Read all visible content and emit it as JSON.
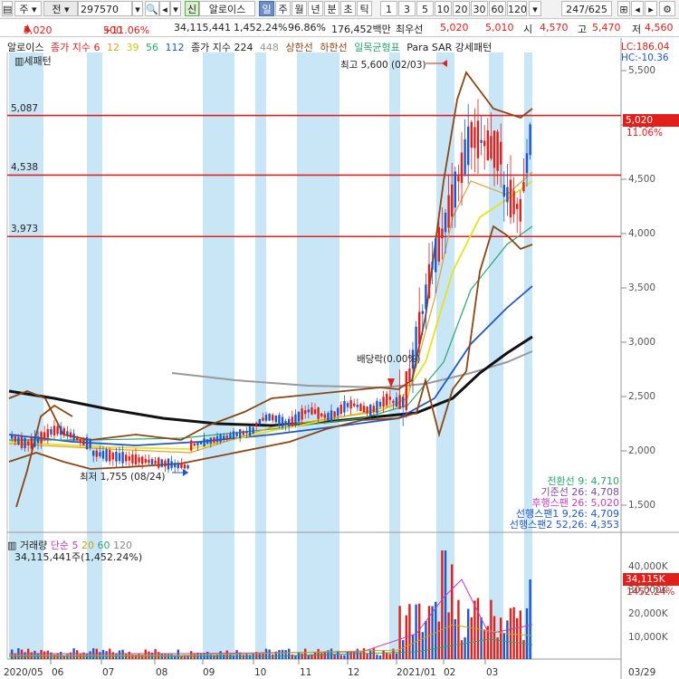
{
  "toolbar": {
    "market": "주",
    "code_label": "전",
    "code": "297570",
    "stock_name": "알로이스",
    "new_badge": "신",
    "period_items": [
      "일",
      "주",
      "월",
      "년",
      "분",
      "초",
      "틱"
    ],
    "selected_period": "일",
    "interval_items": [
      "1",
      "3",
      "5",
      "10",
      "20",
      "30",
      "60",
      "120"
    ],
    "page_counter": "247/625"
  },
  "quote": {
    "price": "5,020",
    "change": "500",
    "change_pct": "+11.06%",
    "volume": "34,115,441",
    "volume_pct": "1,452.24%",
    "volume_pct2": "96.86%",
    "trade_value": "176,452백만",
    "best_label": "최우선",
    "best_price": "5,020",
    "best_price2": "5,010",
    "open_label": "시",
    "open": "4,570",
    "high_label": "고",
    "high": "5,470",
    "low_label": "저",
    "low": "4,560"
  },
  "legend": {
    "name": "알로이스",
    "ma_label": "종가 지수 6",
    "ma_periods": [
      "12",
      "39",
      "56",
      "112"
    ],
    "ma2_label": "종가 지수 224",
    "ma2_period": "448",
    "limit_label": "상한선",
    "limit2_label": "하한선",
    "ichimoku_label": "일목균형표",
    "sar_label": "Para SAR 강세패턴",
    "sar2_label": "세패턴",
    "lc": "LC:186.04",
    "hc": "HC:-10.36"
  },
  "price_axis": [
    "5,500",
    "5,000",
    "4,500",
    "4,000",
    "3,500",
    "3,000",
    "2,500",
    "2,000",
    "1,500"
  ],
  "hlines": [
    {
      "label": "5,087",
      "value": 5087
    },
    {
      "label": "4,538",
      "value": 4538
    },
    {
      "label": "3,973",
      "value": 3973
    }
  ],
  "current_price_badge": "5,020",
  "current_change_badge": "11.06%",
  "annotations": {
    "high": "최고 5,600 (02/03)",
    "low": "최저 1,755 (08/24)",
    "dividend": "배당락(0.00%)"
  },
  "ichimoku_values": [
    {
      "label": "전환선 9: 4,710",
      "color": "#2aa56c"
    },
    {
      "label": "기준선 26: 4,708",
      "color": "#7a4ba3"
    },
    {
      "label": "후행스팬 26: 5,020",
      "color": "#c23fbd"
    },
    {
      "label": "선행스팬1 9,26: 4,709",
      "color": "#1f56c9"
    },
    {
      "label": "선행스팬2 52,26: 4,353",
      "color": "#1f56c9"
    }
  ],
  "volume_legend": {
    "name": "거래량",
    "ma_label": "단순 5",
    "ma_periods": [
      "20",
      "60",
      "120"
    ],
    "value": "34,115,441주(1,452.24%)"
  },
  "volume_axis": [
    "40,000K",
    "30,000K",
    "20,000K",
    "10,000K"
  ],
  "volume_badge": "34,115K",
  "volume_badge2": "1452.24%",
  "x_labels": [
    "2020/05",
    "06",
    "07",
    "08",
    "09",
    "10",
    "11",
    "12",
    "2021/01",
    "02",
    "03",
    "03/29"
  ],
  "colors": {
    "up": "#e0201b",
    "down": "#1f56c9",
    "highlight": "#c9e6f7"
  }
}
